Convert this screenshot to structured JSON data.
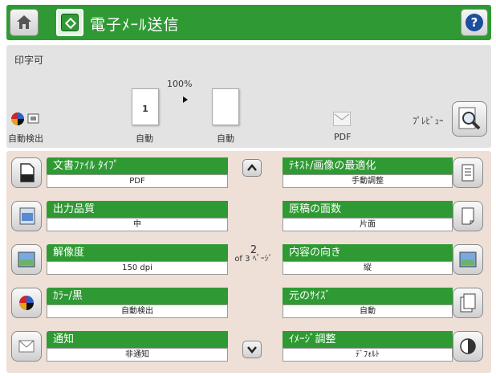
{
  "header": {
    "title": "電子ﾒｰﾙ送信",
    "home_icon": "home-icon",
    "start_icon": "start-icon",
    "help_glyph": "?",
    "accent": "#2f9a34"
  },
  "status": {
    "text": "印字可",
    "zoom": "100%",
    "page_number": "1",
    "autodetect_label": "自動検出",
    "original_label": "自動",
    "output_label": "自動",
    "file_type_label": "PDF",
    "preview_label": "ﾌﾟﾚﾋﾞｭｰ"
  },
  "settings": {
    "left": [
      {
        "title": "文書ﾌｧｲﾙ ﾀｲﾌﾟ",
        "value": "PDF",
        "icon": "document-icon"
      },
      {
        "title": "出力品質",
        "value": "中",
        "icon": "quality-icon"
      },
      {
        "title": "解像度",
        "value": "150 dpi",
        "icon": "resolution-icon"
      },
      {
        "title": "ｶﾗｰ/黒",
        "value": "自動検出",
        "icon": "color-icon"
      },
      {
        "title": "通知",
        "value": "非通知",
        "icon": "notification-icon"
      }
    ],
    "right": [
      {
        "title": "ﾃｷｽﾄ/画像の最適化",
        "value": "手動調整",
        "icon": "optimize-icon"
      },
      {
        "title": "原稿の面数",
        "value": "片面",
        "icon": "sides-icon"
      },
      {
        "title": "内容の向き",
        "value": "縦",
        "icon": "orientation-icon"
      },
      {
        "title": "元のｻｲｽﾞ",
        "value": "自動",
        "icon": "size-icon"
      },
      {
        "title": "ｲﾒｰｼﾞ調整",
        "value": "ﾃﾞﾌｫﾙﾄ",
        "icon": "image-adjust-icon"
      }
    ],
    "page_current": "2",
    "page_total": "of 3 ﾍﾟｰｼﾞ"
  }
}
